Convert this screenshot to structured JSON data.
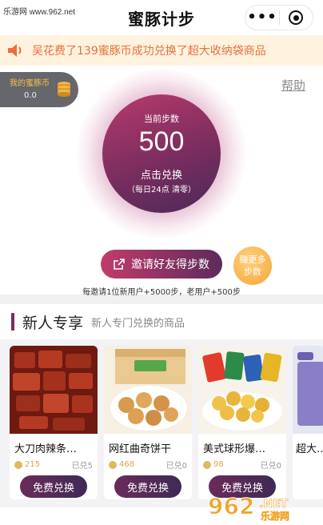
{
  "watermark_top": "乐游网 www.962.net",
  "header": {
    "title": "蜜豚计步",
    "more_label": "•••"
  },
  "notice": {
    "text": "吴花费了139蜜豚币成功兑换了超大收纳袋商品"
  },
  "coins": {
    "label": "我的蜜豚币",
    "value": "0.0"
  },
  "help_label": "帮助",
  "steps": {
    "current_label": "当前步数",
    "value": "500",
    "action_label": "点击兑换",
    "reset_note": "（每日24点 清零）"
  },
  "invite": {
    "button_label": "邀请好友得步数",
    "more_line1": "赚更多",
    "more_line2": "步数",
    "rule": "每邀请1位新用户+5000步，老用户+500步"
  },
  "section": {
    "title": "新人专享",
    "subtitle": "新人专门兑换的商品"
  },
  "products": [
    {
      "name": "大刀肉辣条…",
      "price": "215",
      "redeemed": "已兑5",
      "button": "免费兑换"
    },
    {
      "name": "网红曲奇饼干",
      "price": "468",
      "redeemed": "已兑0",
      "button": "免费兑换"
    },
    {
      "name": "美式球形爆…",
      "price": "98",
      "redeemed": "已兑0",
      "button": "免费兑换"
    },
    {
      "name": "超大…",
      "price": "",
      "redeemed": "",
      "button": ""
    }
  ],
  "colors": {
    "accent": "#7b2c5e",
    "notice_text": "#e8703a",
    "gold": "#f4a63a"
  },
  "watermark_bottom": {
    "brand": "962",
    "suffix": ".NET",
    "site": "乐游网"
  }
}
